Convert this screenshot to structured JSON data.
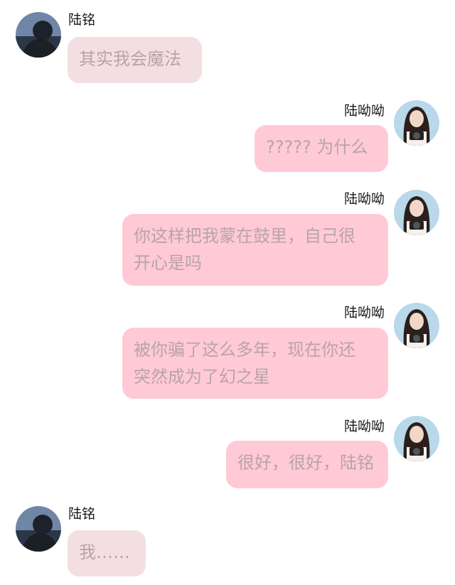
{
  "messages": [
    {
      "sender": "陆铭",
      "lines": [
        "其实我会魔法"
      ],
      "side": "left"
    },
    {
      "sender": "陆呦呦",
      "lines": [
        "????? 为什么"
      ],
      "side": "right"
    },
    {
      "sender": "陆呦呦",
      "lines": [
        "你这样把我蒙在鼓里，自己很",
        "开心是吗"
      ],
      "side": "right"
    },
    {
      "sender": "陆呦呦",
      "lines": [
        "被你骗了这么多年，现在你还",
        "突然成为了幻之星"
      ],
      "side": "right"
    },
    {
      "sender": "陆呦呦",
      "lines": [
        "很好，很好，陆铭"
      ],
      "side": "right"
    },
    {
      "sender": "陆铭",
      "lines": [
        "我……"
      ],
      "side": "left"
    }
  ],
  "colors": {
    "left_bubble": "#f3dfe2",
    "right_bubble": "#ffcad5",
    "bubble_text": "#b9a3ab",
    "name_text": "#1a1a1a"
  },
  "icons": {
    "left_avatar": "avatar-luming-icon",
    "right_avatar": "avatar-luyouyou-icon"
  }
}
